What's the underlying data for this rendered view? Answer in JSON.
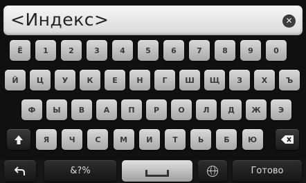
{
  "input": {
    "placeholder": "<Индекс>"
  },
  "keyboard": {
    "row1": [
      "Ё",
      "1",
      "2",
      "3",
      "4",
      "5",
      "6",
      "7",
      "8",
      "9",
      "0"
    ],
    "row2": [
      "Й",
      "Ц",
      "У",
      "К",
      "Е",
      "Н",
      "Г",
      "Ш",
      "Щ",
      "З",
      "Х",
      "Ъ"
    ],
    "row3": [
      "Ф",
      "Ы",
      "В",
      "А",
      "П",
      "Р",
      "О",
      "Л",
      "Д",
      "Ж",
      "Э"
    ],
    "row4": [
      "Я",
      "Ч",
      "С",
      "М",
      "И",
      "Т",
      "Ь",
      "Б",
      "Ю"
    ],
    "symbols_label": "&?%",
    "done_label": "Готово"
  },
  "icons": {
    "clear": "clear-x-icon",
    "shift": "shift-arrow-icon",
    "backspace": "backspace-icon",
    "back": "back-arrow-icon",
    "space": "space-bar-icon",
    "language": "globe-icon"
  }
}
